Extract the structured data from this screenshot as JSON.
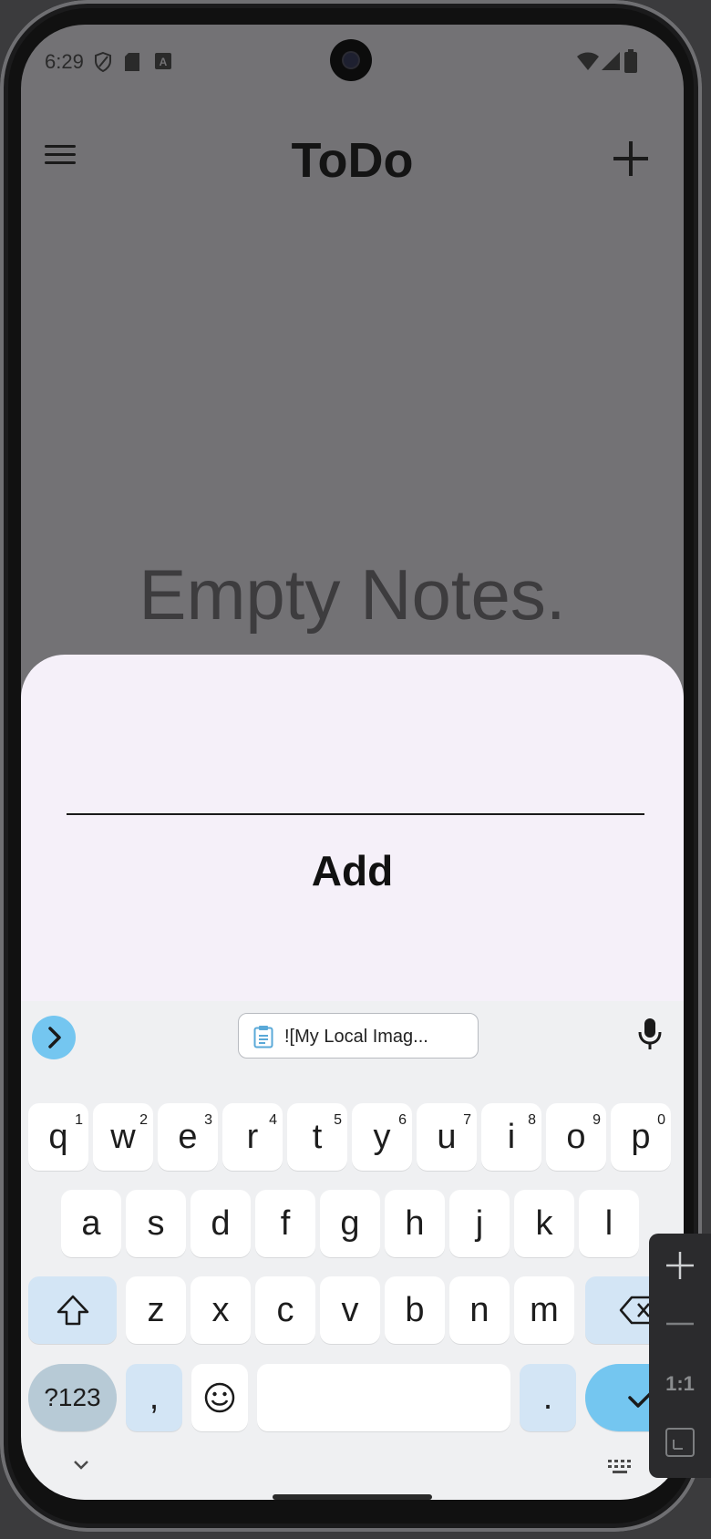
{
  "status_bar": {
    "time": "6:29"
  },
  "app_bar": {
    "title": "ToDo"
  },
  "main": {
    "empty_message": "Empty Notes."
  },
  "sheet": {
    "input_value": "",
    "add_label": "Add"
  },
  "keyboard": {
    "clipboard_text": "![My Local Imag...",
    "row1": [
      {
        "label": "q",
        "hint": "1"
      },
      {
        "label": "w",
        "hint": "2"
      },
      {
        "label": "e",
        "hint": "3"
      },
      {
        "label": "r",
        "hint": "4"
      },
      {
        "label": "t",
        "hint": "5"
      },
      {
        "label": "y",
        "hint": "6"
      },
      {
        "label": "u",
        "hint": "7"
      },
      {
        "label": "i",
        "hint": "8"
      },
      {
        "label": "o",
        "hint": "9"
      },
      {
        "label": "p",
        "hint": "0"
      }
    ],
    "row2": [
      "a",
      "s",
      "d",
      "f",
      "g",
      "h",
      "j",
      "k",
      "l"
    ],
    "row3": [
      "z",
      "x",
      "c",
      "v",
      "b",
      "n",
      "m"
    ],
    "symbols_label": "?123",
    "comma_label": ",",
    "period_label": "."
  },
  "side_panel": {
    "ratio_label": "1:1"
  },
  "colors": {
    "accent": "#74c6f0",
    "sheet_bg": "#f5f0f9",
    "scrim": "#737275"
  }
}
